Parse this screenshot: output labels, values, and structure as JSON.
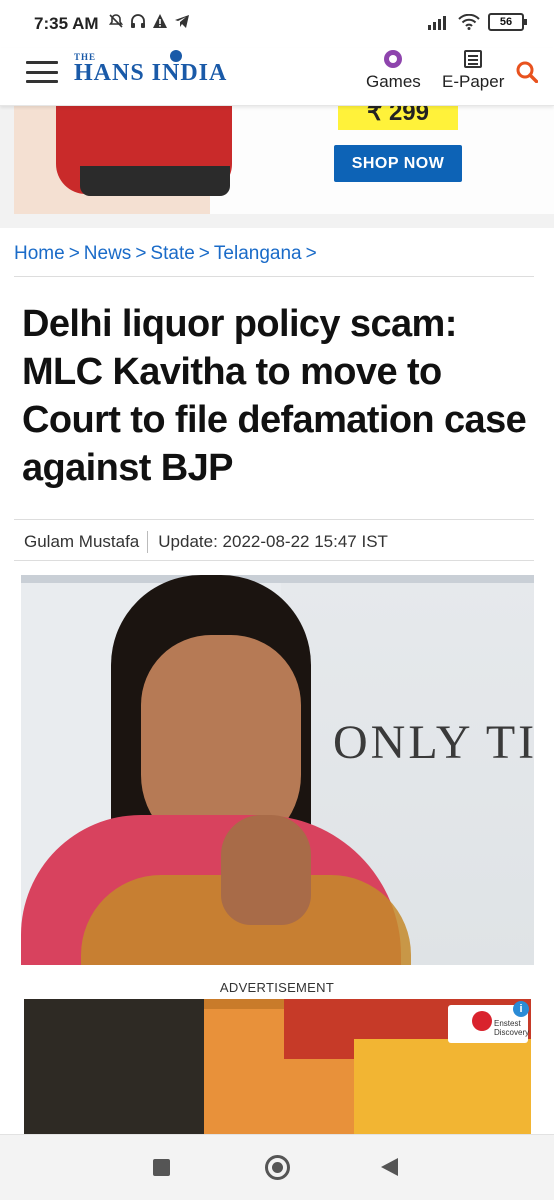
{
  "status_bar": {
    "time": "7:35 AM",
    "battery": "56",
    "icons_left": [
      "mute-icon",
      "headphones-icon",
      "warning-icon",
      "telegram-icon"
    ],
    "icons_right": [
      "signal-icon",
      "wifi-icon",
      "battery-icon"
    ]
  },
  "header": {
    "logo_the": "THE",
    "logo_main": "HANS INDIA",
    "games_label": "Games",
    "epaper_label": "E-Paper",
    "brand_color": "#1a5aa8",
    "search_icon_color": "#e8521e"
  },
  "top_ad": {
    "price": "₹ 299",
    "cta": "SHOP NOW"
  },
  "breadcrumb": [
    {
      "label": "Home"
    },
    {
      "label": "News"
    },
    {
      "label": "State"
    },
    {
      "label": "Telangana"
    }
  ],
  "article": {
    "headline": "Delhi liquor policy scam: MLC Kavitha to move to Court to file defamation case against BJP",
    "author": "Gulam Mustafa",
    "updated": "Update: 2022-08-22 15:47 IST",
    "image_banner_text": "ONLY TI"
  },
  "advertisement": {
    "label": "ADVERTISEMENT",
    "brand_text": "Enstest Discovery"
  },
  "link_color": "#1a6bc8"
}
